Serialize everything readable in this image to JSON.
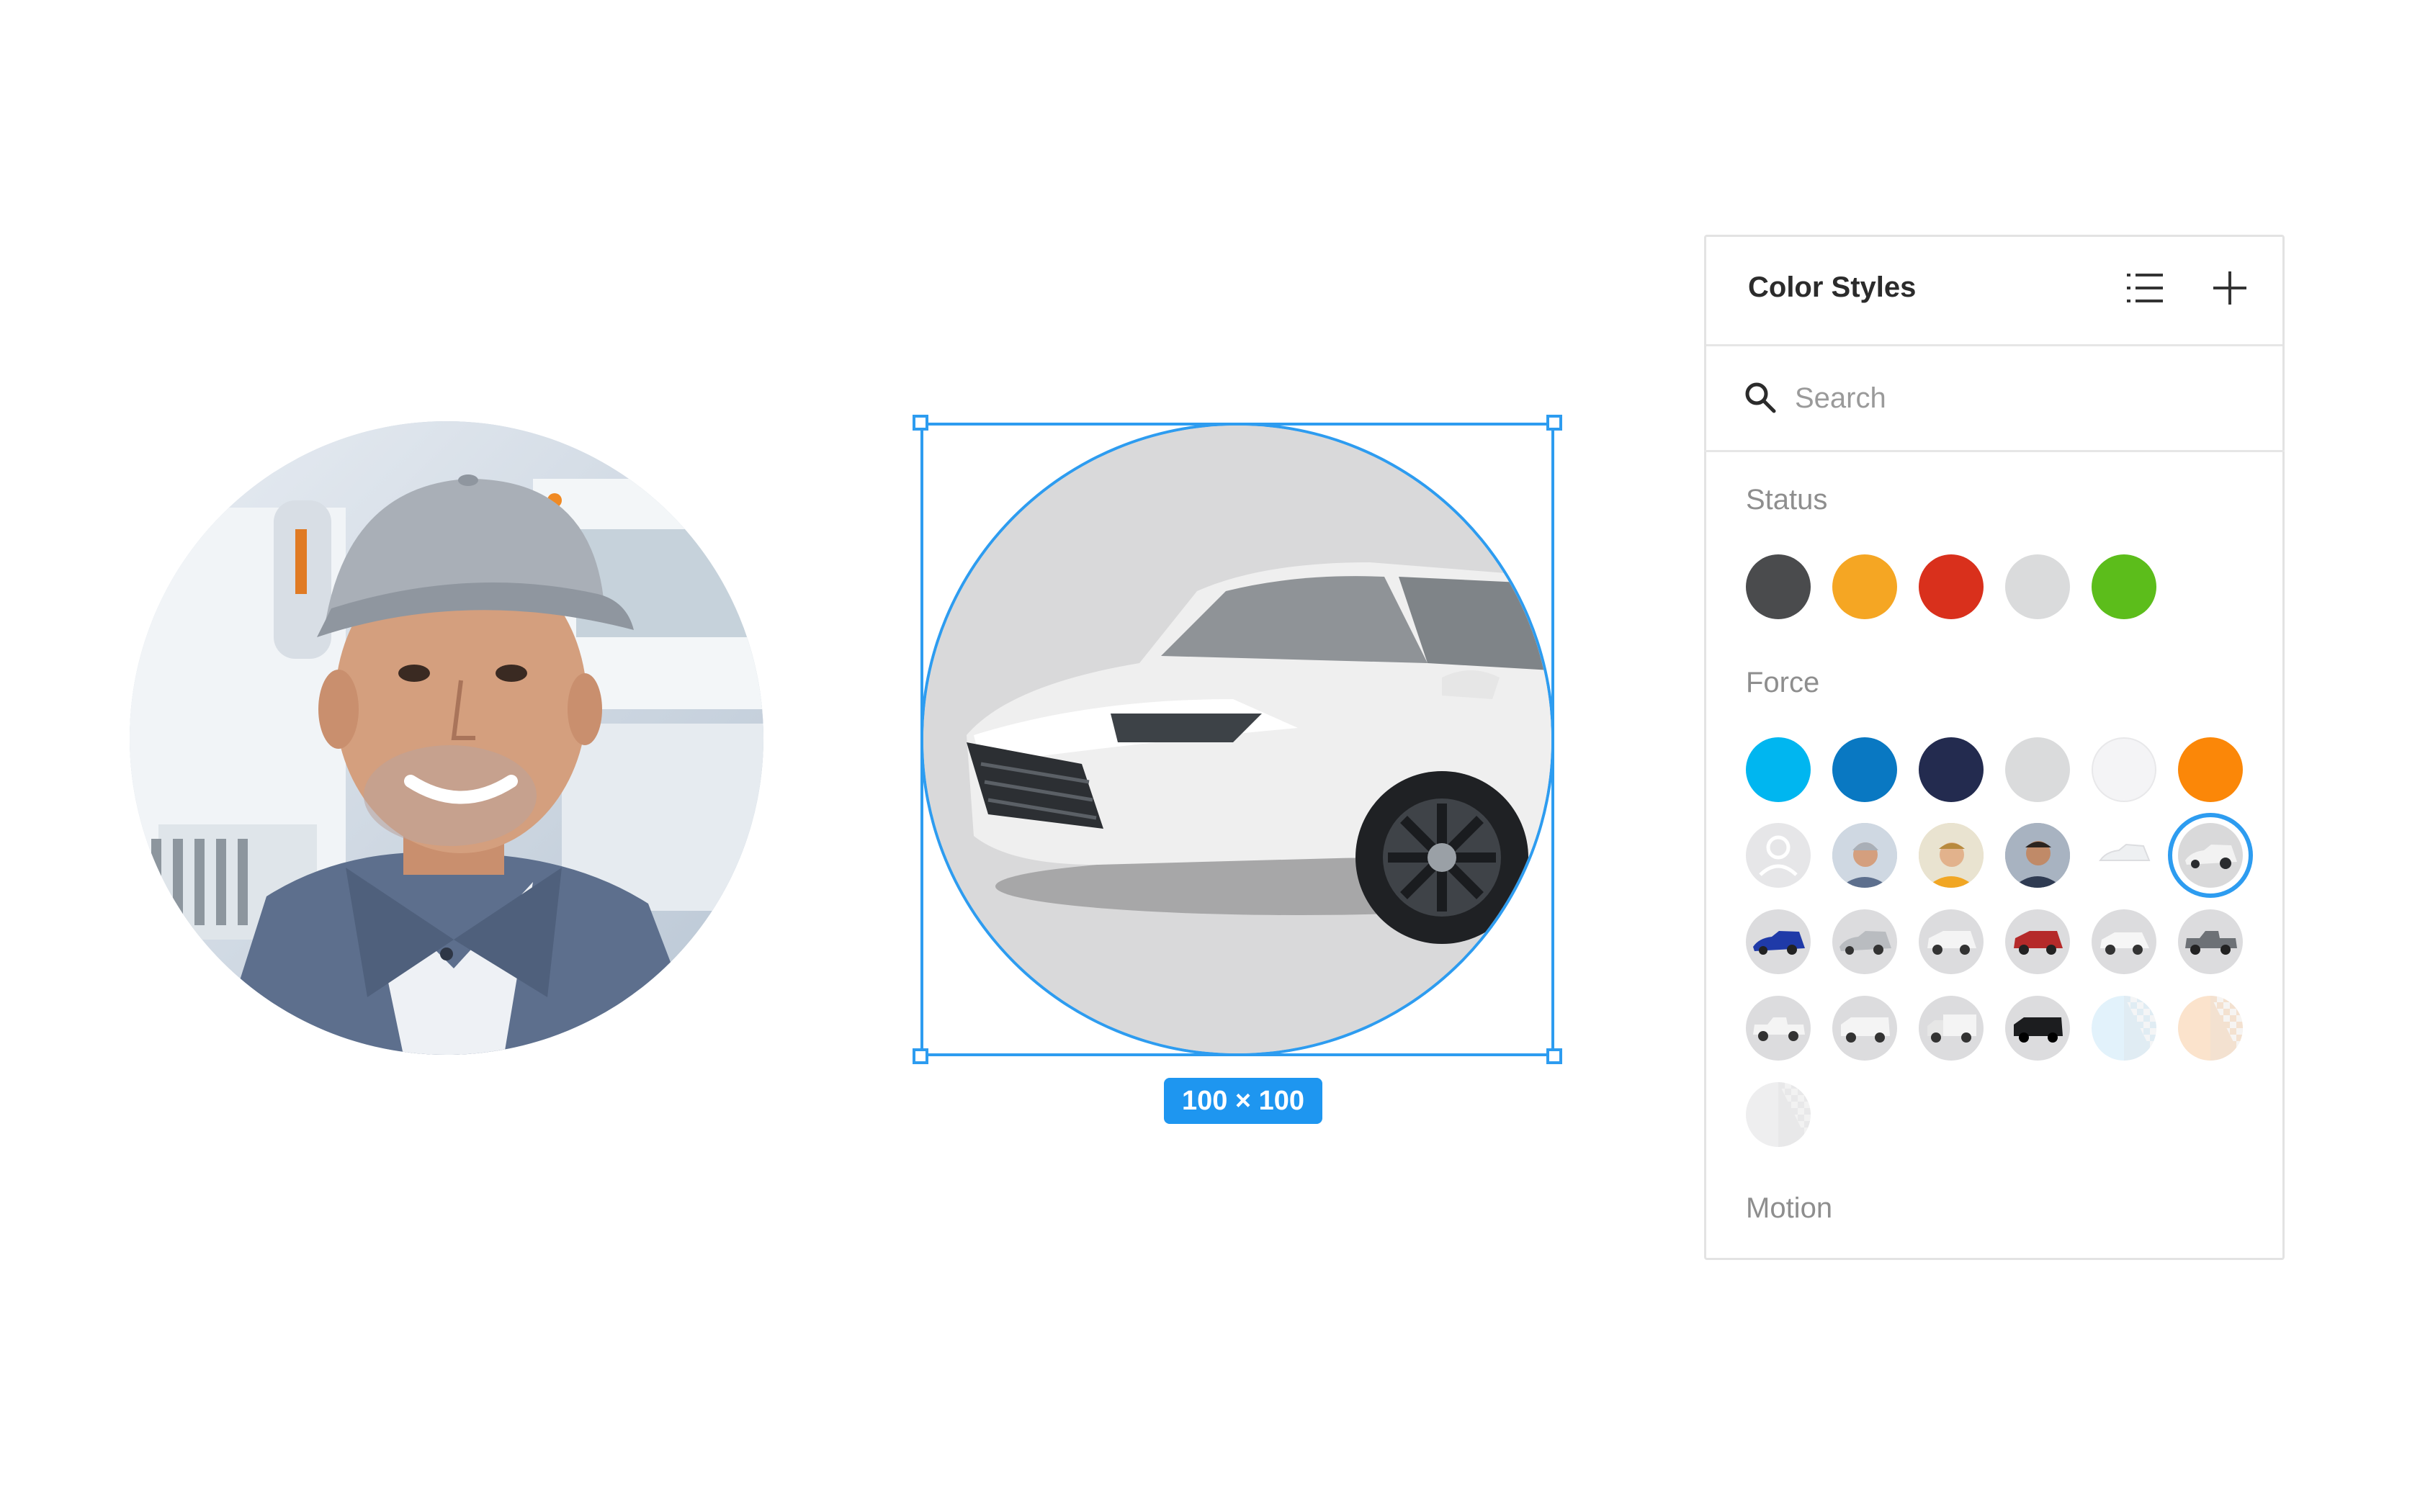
{
  "canvas": {
    "selection_size": "100 × 100"
  },
  "panel": {
    "title": "Color Styles",
    "list_view_icon": "list-view-icon",
    "add_icon": "plus-icon",
    "search": {
      "placeholder": "Search",
      "value": ""
    },
    "sections": {
      "status": {
        "label": "Status",
        "colors": [
          "#4a4b4d",
          "#f5a623",
          "#d9301c",
          "#dadbdc",
          "#5cbd1b"
        ]
      },
      "force": {
        "label": "Force",
        "colors": [
          "#00b6f0",
          "#0978c2",
          "#232b4f",
          "#dadbdc",
          "#f4f4f6",
          "#fb8708"
        ],
        "image_styles": [
          "person-placeholder",
          "driver-photo-1",
          "driver-photo-2",
          "driver-photo-3",
          "car-silhouette-white",
          "car-white-sedan",
          "car-blue-sedan",
          "car-silver-sedan",
          "car-white-suv",
          "car-red-suv",
          "car-white-crossover",
          "car-gray-pickup",
          "car-white-pickup",
          "car-white-van",
          "car-white-box-truck",
          "car-black-van",
          "transparent-light-blue",
          "transparent-peach",
          "transparent-gray"
        ],
        "selected_style": "car-white-sedan"
      },
      "motion": {
        "label": "Motion"
      }
    }
  },
  "colors": {
    "selection": "#2d9cf0",
    "badge": "#1e96f0",
    "car_avatar_background": "#d9d9da"
  }
}
